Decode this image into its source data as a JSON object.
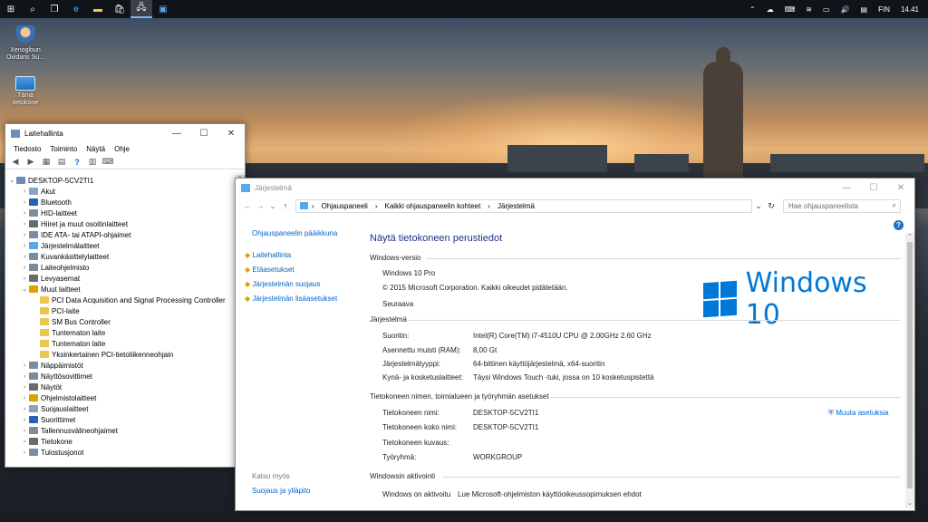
{
  "taskbar": {
    "language": "FIN",
    "clock": "14.41"
  },
  "desktop": {
    "icons": [
      {
        "label": "Xenogloun Ovidaris Su..."
      },
      {
        "label": "Tämä tietokone"
      }
    ]
  },
  "device_manager": {
    "title": "Laitehallinta",
    "menu": [
      "Tiedosto",
      "Toiminto",
      "Näytä",
      "Ohje"
    ],
    "root": "DESKTOP-5CV2TI1",
    "items": [
      {
        "label": "Akut",
        "level": 1
      },
      {
        "label": "Bluetooth",
        "level": 1
      },
      {
        "label": "HID-laitteet",
        "level": 1
      },
      {
        "label": "Hiiret ja muut osoitinlaitteet",
        "level": 1
      },
      {
        "label": "IDE ATA- tai ATAPI-ohjaimet",
        "level": 1
      },
      {
        "label": "Järjestelmälaitteet",
        "level": 1
      },
      {
        "label": "Kuvankäsittelylaitteet",
        "level": 1
      },
      {
        "label": "Laiteohjelmisto",
        "level": 1
      },
      {
        "label": "Levyasemat",
        "level": 1
      },
      {
        "label": "Muut laitteet",
        "level": 1,
        "expanded": true
      },
      {
        "label": "PCI Data Acquisition and Signal Processing Controller",
        "level": 2
      },
      {
        "label": "PCI-laite",
        "level": 2
      },
      {
        "label": "SM Bus Controller",
        "level": 2
      },
      {
        "label": "Tuntematon laite",
        "level": 2
      },
      {
        "label": "Tuntematon laite",
        "level": 2
      },
      {
        "label": "Yksinkertainen PCI-tietoliikenneohjain",
        "level": 2
      },
      {
        "label": "Näppäimistöt",
        "level": 1
      },
      {
        "label": "Näyttösovittimet",
        "level": 1
      },
      {
        "label": "Näytöt",
        "level": 1
      },
      {
        "label": "Ohjelmistolaitteet",
        "level": 1
      },
      {
        "label": "Suojauslaitteet",
        "level": 1
      },
      {
        "label": "Suorittimet",
        "level": 1
      },
      {
        "label": "Tallennusvälineohjaimet",
        "level": 1
      },
      {
        "label": "Tietokone",
        "level": 1
      },
      {
        "label": "Tulostusjonot",
        "level": 1
      }
    ]
  },
  "system_window": {
    "title": "Järjestelmä",
    "breadcrumb": [
      "Ohjauspaneeli",
      "Kaikki ohjauspaneelin kohteet",
      "Järjestelmä"
    ],
    "search_placeholder": "Hae ohjauspaneelista",
    "side": {
      "home": "Ohjauspaneelin pääikkuna",
      "links": [
        "Laitehallinta",
        "Etäasetukset",
        "Järjestelmän suojaus",
        "Järjestelmän lisäasetukset"
      ],
      "see_also": "Katso myös",
      "see_also_link": "Suojaus ja ylläpito"
    },
    "heading": "Näytä tietokoneen perustiedot",
    "edition_section": "Windows-versio",
    "edition": "Windows 10 Pro",
    "copyright": "© 2015 Microsoft Corporation. Kaikki oikeudet pidätetään.",
    "next_link": "Seuraava",
    "logo_text": "Windows 10",
    "system_section": "Järjestelmä",
    "system": [
      {
        "label": "Suoritin:",
        "value": "Intel(R) Core(TM) i7-4510U CPU @ 2.00GHz   2.60 GHz"
      },
      {
        "label": "Asennettu muisti (RAM):",
        "value": "8,00 Gt"
      },
      {
        "label": "Järjestelmätyyppi:",
        "value": "64-bittinen käyttöjärjestelmä, x64-suoritin"
      },
      {
        "label": "Kynä- ja kosketuslaitteet:",
        "value": "Täysi Windows Touch -tuki, jossa on 10 kosketuspistettä"
      }
    ],
    "computer_section": "Tietokoneen nimen, toimialueen ja työryhmän asetukset",
    "computer": [
      {
        "label": "Tietokoneen nimi:",
        "value": "DESKTOP-5CV2TI1"
      },
      {
        "label": "Tietokoneen koko nimi:",
        "value": "DESKTOP-5CV2TI1"
      },
      {
        "label": "Tietokoneen kuvaus:",
        "value": ""
      },
      {
        "label": "Työryhmä:",
        "value": "WORKGROUP"
      }
    ],
    "change_settings": "Muuta asetuksia",
    "activation_section": "Windowsin aktivointi",
    "activation_label": "Windows on aktivoitu",
    "activation_link": "Lue Microsoft-ohjelmiston käyttöoikeussopimuksen ehdot"
  }
}
